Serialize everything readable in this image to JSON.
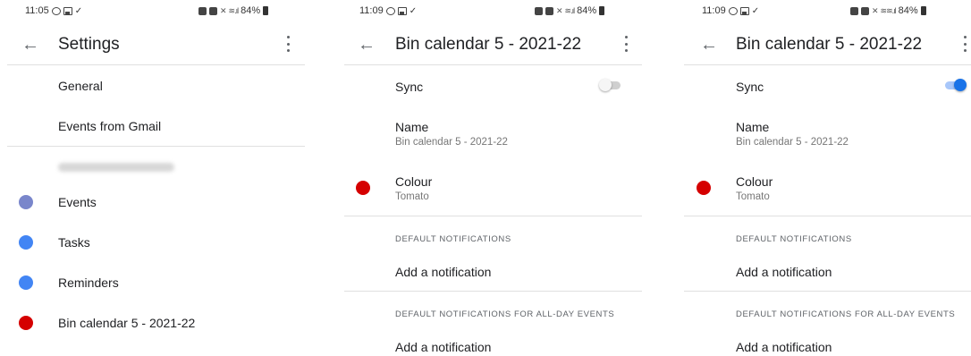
{
  "colors": {
    "events": "#7986cb",
    "tasks": "#4285f4",
    "reminders": "#4285f4",
    "tomato": "#d50000",
    "toggle_on": "#1a73e8"
  },
  "screen1": {
    "status": {
      "time": "11:05",
      "battery": "84%"
    },
    "title": "Settings",
    "items": {
      "general": "General",
      "events_from_gmail": "Events from Gmail",
      "events": "Events",
      "tasks": "Tasks",
      "reminders": "Reminders",
      "bin_calendar": "Bin calendar 5 - 2021-22"
    }
  },
  "screen2": {
    "status": {
      "time": "11:09",
      "battery": "84%"
    },
    "title": "Bin calendar 5 - 2021-22",
    "sync_label": "Sync",
    "sync_on": false,
    "name_label": "Name",
    "name_value": "Bin calendar 5 - 2021-22",
    "colour_label": "Colour",
    "colour_value": "Tomato",
    "default_notifications_header": "DEFAULT NOTIFICATIONS",
    "add_notification_1": "Add a notification",
    "all_day_header": "DEFAULT NOTIFICATIONS FOR ALL-DAY EVENTS",
    "add_notification_2": "Add a notification"
  },
  "screen3": {
    "status": {
      "time": "11:09",
      "battery": "84%"
    },
    "title": "Bin calendar 5 - 2021-22",
    "sync_label": "Sync",
    "sync_on": true,
    "name_label": "Name",
    "name_value": "Bin calendar 5 - 2021-22",
    "colour_label": "Colour",
    "colour_value": "Tomato",
    "default_notifications_header": "DEFAULT NOTIFICATIONS",
    "add_notification_1": "Add a notification",
    "all_day_header": "DEFAULT NOTIFICATIONS FOR ALL-DAY EVENTS",
    "add_notification_2": "Add a notification"
  }
}
